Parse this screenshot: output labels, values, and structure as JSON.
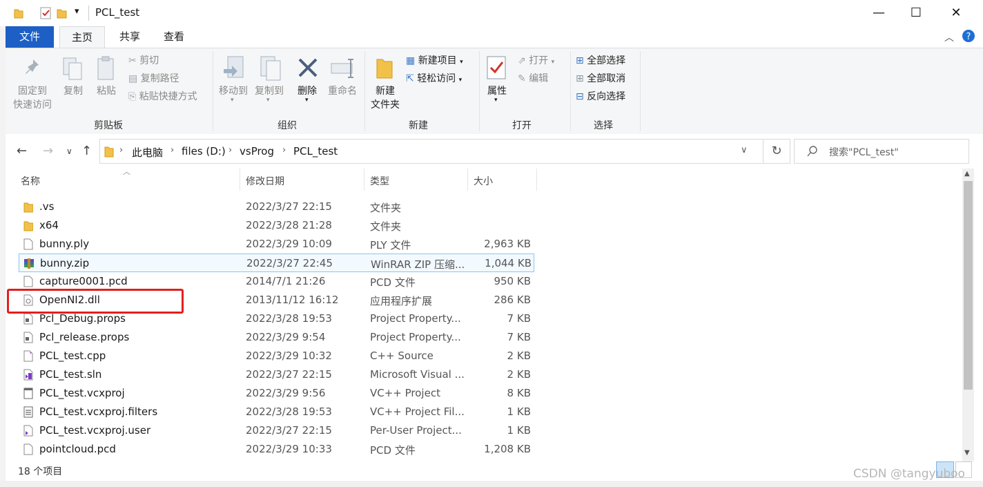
{
  "window": {
    "title": "PCL_test",
    "qat_dropdown": "▾",
    "minimize": "—",
    "maximize": "☐",
    "close": "✕"
  },
  "tabs": [
    "文件",
    "主页",
    "共享",
    "查看"
  ],
  "ribbon": {
    "groups": {
      "clipboard": "剪贴板",
      "organize": "组织",
      "new": "新建",
      "open": "打开",
      "select": "选择"
    },
    "pin": [
      "固定到",
      "快速访问"
    ],
    "copy": "复制",
    "paste": "粘贴",
    "cut": "剪切",
    "copy_path": "复制路径",
    "paste_shortcut": "粘贴快捷方式",
    "move_to": "移动到",
    "copy_to": "复制到",
    "delete": "删除",
    "rename": "重命名",
    "new_folder": [
      "新建",
      "文件夹"
    ],
    "new_item": "新建项目",
    "easy_access": "轻松访问",
    "properties": "属性",
    "open": "打开",
    "edit": "编辑",
    "select_all": "全部选择",
    "select_none": "全部取消",
    "invert_selection": "反向选择"
  },
  "address": {
    "crumbs": [
      "此电脑",
      "files (D:)",
      "vsProg",
      "PCL_test"
    ],
    "search_placeholder": "搜索\"PCL_test\""
  },
  "columns": {
    "name": "名称",
    "date": "修改日期",
    "type": "类型",
    "size": "大小"
  },
  "files": [
    {
      "name": ".vs",
      "date": "2022/3/27 22:15",
      "type": "文件夹",
      "size": "",
      "icon": "folder-icon"
    },
    {
      "name": "x64",
      "date": "2022/3/28 21:28",
      "type": "文件夹",
      "size": "",
      "icon": "folder-icon"
    },
    {
      "name": "bunny.ply",
      "date": "2022/3/29 10:09",
      "type": "PLY 文件",
      "size": "2,963 KB",
      "icon": "file-icon"
    },
    {
      "name": "bunny.zip",
      "date": "2022/3/27 22:45",
      "type": "WinRAR ZIP 压缩...",
      "size": "1,044 KB",
      "icon": "winrar-icon"
    },
    {
      "name": "capture0001.pcd",
      "date": "2014/7/1 21:26",
      "type": "PCD 文件",
      "size": "950 KB",
      "icon": "file-icon"
    },
    {
      "name": "OpenNI2.dll",
      "date": "2013/11/12 16:12",
      "type": "应用程序扩展",
      "size": "286 KB",
      "icon": "dll-icon"
    },
    {
      "name": "Pcl_Debug.props",
      "date": "2022/3/28 19:53",
      "type": "Project Property...",
      "size": "7 KB",
      "icon": "props-icon"
    },
    {
      "name": "Pcl_release.props",
      "date": "2022/3/29 9:54",
      "type": "Project Property...",
      "size": "7 KB",
      "icon": "props-icon"
    },
    {
      "name": "PCL_test.cpp",
      "date": "2022/3/29 10:32",
      "type": "C++ Source",
      "size": "2 KB",
      "icon": "cpp-icon"
    },
    {
      "name": "PCL_test.sln",
      "date": "2022/3/27 22:15",
      "type": "Microsoft Visual ...",
      "size": "2 KB",
      "icon": "sln-icon"
    },
    {
      "name": "PCL_test.vcxproj",
      "date": "2022/3/29 9:56",
      "type": "VC++ Project",
      "size": "8 KB",
      "icon": "vcxproj-icon"
    },
    {
      "name": "PCL_test.vcxproj.filters",
      "date": "2022/3/28 19:53",
      "type": "VC++ Project Fil...",
      "size": "1 KB",
      "icon": "filters-icon"
    },
    {
      "name": "PCL_test.vcxproj.user",
      "date": "2022/3/27 22:15",
      "type": "Per-User Project...",
      "size": "1 KB",
      "icon": "user-icon"
    },
    {
      "name": "pointcloud.pcd",
      "date": "2022/3/29 10:33",
      "type": "PCD 文件",
      "size": "1,208 KB",
      "icon": "file-icon"
    }
  ],
  "status": {
    "count": "18 个项目"
  },
  "watermark": "CSDN @tangyuboo",
  "colors": {
    "file_tab": "#1d5fc5",
    "highlight_border": "#e0201f",
    "selection_border": "#8cc4f0"
  }
}
